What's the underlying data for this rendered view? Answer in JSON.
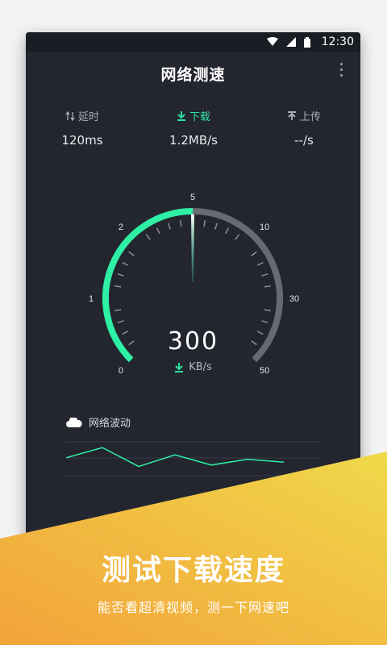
{
  "status": {
    "time": "12:30"
  },
  "app": {
    "title": "网络测速"
  },
  "metrics": [
    {
      "label": "延时",
      "value": "120ms"
    },
    {
      "label": "下载",
      "value": "1.2MB/s"
    },
    {
      "label": "上传",
      "value": "--/s"
    }
  ],
  "gauge": {
    "scale_labels": [
      "0",
      "1",
      "2",
      "5",
      "10",
      "30",
      "50"
    ],
    "speed": "300",
    "unit": "KB/s",
    "accent": "#2ef0a5",
    "track": "#666a72"
  },
  "wave": {
    "title": "网络波动",
    "points": [
      0.55,
      0.2,
      0.85,
      0.45,
      0.8,
      0.6,
      0.7
    ]
  },
  "banner": {
    "headline": "测试下载速度",
    "subline": "能否看超清视频，测一下网速吧",
    "gradient_start": "#f2a23a",
    "gradient_end": "#f0d94a"
  }
}
